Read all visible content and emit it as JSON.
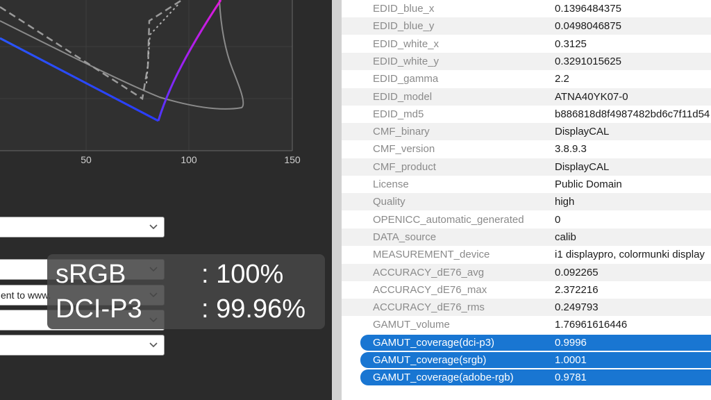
{
  "chart": {
    "x_ticks": [
      "50",
      "100",
      "150"
    ]
  },
  "combos": [
    {
      "text": ""
    },
    {
      "text": ""
    },
    {
      "text": "ent to www."
    },
    {
      "text": ""
    },
    {
      "text": ""
    }
  ],
  "overlay": {
    "items": [
      {
        "name": "sRGB",
        "value": ": 100%"
      },
      {
        "name": "DCI-P3",
        "value": ": 99.96%"
      }
    ]
  },
  "metadata": {
    "rows": [
      {
        "key": "EDID_blue_x",
        "value": "0.1396484375"
      },
      {
        "key": "EDID_blue_y",
        "value": "0.0498046875"
      },
      {
        "key": "EDID_white_x",
        "value": "0.3125"
      },
      {
        "key": "EDID_white_y",
        "value": "0.3291015625"
      },
      {
        "key": "EDID_gamma",
        "value": "2.2"
      },
      {
        "key": "EDID_model",
        "value": "ATNA40YK07-0"
      },
      {
        "key": "EDID_md5",
        "value": "b886818d8f4987482bd6c7f11d54"
      },
      {
        "key": "CMF_binary",
        "value": "DisplayCAL"
      },
      {
        "key": "CMF_version",
        "value": "3.8.9.3"
      },
      {
        "key": "CMF_product",
        "value": "DisplayCAL"
      },
      {
        "key": "License",
        "value": "Public Domain"
      },
      {
        "key": "Quality",
        "value": "high"
      },
      {
        "key": "OPENICC_automatic_generated",
        "value": "0"
      },
      {
        "key": "DATA_source",
        "value": "calib"
      },
      {
        "key": "MEASUREMENT_device",
        "value": "i1 displaypro, colormunki display"
      },
      {
        "key": "ACCURACY_dE76_avg",
        "value": "0.092265"
      },
      {
        "key": "ACCURACY_dE76_max",
        "value": "2.372216"
      },
      {
        "key": "ACCURACY_dE76_rms",
        "value": "0.249793"
      },
      {
        "key": "GAMUT_volume",
        "value": "1.76961616446"
      },
      {
        "key": "GAMUT_coverage(dci-p3)",
        "value": "0.9996",
        "selected": true
      },
      {
        "key": "GAMUT_coverage(srgb)",
        "value": "1.0001",
        "selected": true
      },
      {
        "key": "GAMUT_coverage(adobe-rgb)",
        "value": "0.9781",
        "selected": true
      }
    ]
  },
  "colors": {
    "selection": "#1976d2",
    "panel_dark": "#2b2b2b"
  }
}
